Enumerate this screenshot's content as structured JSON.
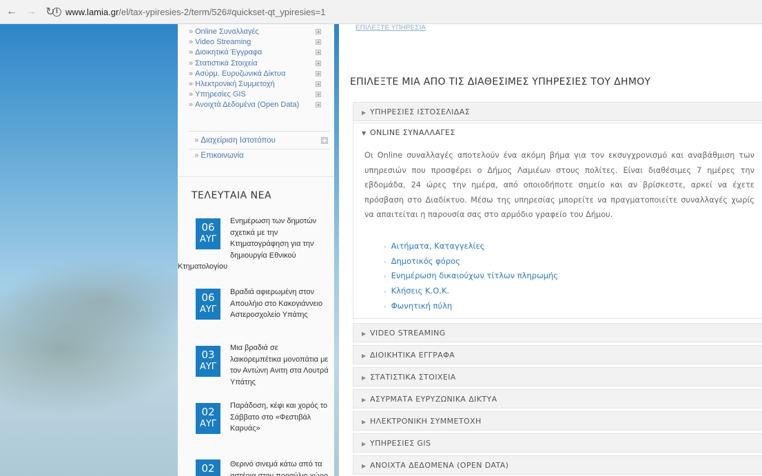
{
  "browser": {
    "url_host": "www.lamia.gr",
    "url_path": "/el/tax-ypiresies-2/term/526#quickset-qt_ypiresies=1"
  },
  "sidebar": {
    "submenu": [
      {
        "label": "Online Συναλλαγές"
      },
      {
        "label": "Video Streaming"
      },
      {
        "label": "Διοικητικά Έγγραφα"
      },
      {
        "label": "Στατιστικά Στοιχεία"
      },
      {
        "label": "Ασύρμ. Ευρυζωνικά Δίκτυα"
      },
      {
        "label": "Ηλεκτρονική Συμμετοχή"
      },
      {
        "label": "Υπηρεσίες GIS"
      },
      {
        "label": "Ανοιχτά Δεδομένα (Open Data)"
      }
    ],
    "main_items": [
      {
        "label": "Διαχείριση Ιστοτόπου"
      },
      {
        "label": "Επικοινωνία"
      }
    ],
    "news_heading": "ΤΕΛΕΥΤΑΙΑ ΝΕΑ",
    "news": [
      {
        "day": "06",
        "month": "ΑΥΓ",
        "text": "Ενημέρωση των δημοτών σχετικά με την Κτηματογράφηση για την δημιουργία Εθνικού Κτηματολογίου"
      },
      {
        "day": "06",
        "month": "ΑΥΓ",
        "text": "Βραδιά αφιερωμένη στον Απουλήιο στο Κακογιάννειο Αστεροσχολείο Υπάτης"
      },
      {
        "day": "03",
        "month": "ΑΥΓ",
        "text": "Μια βραδιά σε λαικορεμπέτικα μονοπάτια με τον Αντώνη Ανιτη στα Λουτρά Υπάτης"
      },
      {
        "day": "02",
        "month": "ΑΥΓ",
        "text": "Παράδοση, κέφι και χορός το Σάββατο στο «Φεστιβάλ Καρυάς»"
      },
      {
        "day": "02",
        "month": "",
        "text": "Θερινό σινεμά κάτω από τα αστέρια στον προαύλιο χώρο"
      }
    ]
  },
  "main": {
    "top_link": "ΕΠΙΛΕΞΤΕ ΥΠΗΡΕΣΙΑ",
    "section_title": "ΕΠΙΛΕΞΤΕ ΜΙΑ ΑΠΟ ΤΙΣ ΔΙΑΘΕΣΙΜΕΣ ΥΠΗΡΕΣΙΕΣ ΤΟΥ ΔΗΜΟΥ",
    "accordion_top": {
      "label": "ΥΠΗΡΕΣΙΕΣ ΙΣΤΟΣΕΛΙΔΑΣ"
    },
    "open_section": {
      "label": "ONLINE ΣΥΝΑΛΛΑΓΕΣ",
      "body": "Οι Online συναλλαγές αποτελούν ένα ακόμη βήμα για τον εκσυγχρονισμό και αναβάθμιση των υπηρεσιών που προσφέρει ο Δήμος Λαμιέων στους πολίτες. Είναι διαθέσιμες 7 ημέρες την εβδομάδα, 24 ώρες την ημέρα, από οποιοδήποτε σημείο και αν βρίσκεστε, αρκεί να έχετε πρόσβαση στο Διαδίκτυο. Μέσω της υπηρεσίας μπορείτε να πραγματοποιείτε συναλλαγές χωρίς να απαιτείται η παρουσία σας στο αρμόδιο γραφείο του Δήμου.",
      "links": [
        {
          "label": "Αιτήματα, Καταγγελίες"
        },
        {
          "label": "Δημοτικός φόρος"
        },
        {
          "label": "Ενημέρωση δικαιούχων τίτλων πληρωμής"
        },
        {
          "label": "Κλήσεις Κ.Ο.Κ."
        },
        {
          "label": "Φωνητική πύλη"
        }
      ]
    },
    "accordion": [
      {
        "label": "VIDEO STREAMING"
      },
      {
        "label": "ΔΙΟΙΚΗΤΙΚΑ ΕΓΓΡΑΦΑ"
      },
      {
        "label": "ΣΤΑΤΙΣΤΙΚΑ ΣΤΟΙΧΕΙΑ"
      },
      {
        "label": "ΑΣΥΡΜΑΤΑ ΕΥΡΥΖΩΝΙΚΑ ΔΙΚΤΥΑ"
      },
      {
        "label": "ΗΛΕΚΤΡΟΝΙΚΗ ΣΥΜΜΕΤΟΧΗ"
      },
      {
        "label": "ΥΠΗΡΕΣΙΕΣ GIS"
      },
      {
        "label": "ΑΝΟΙΧΤΑ ΔΕΔΟΜΕΝΑ (OPEN DATA)"
      }
    ]
  },
  "colors": {
    "accent": "#1a7dc1",
    "link": "#2c78b9",
    "accordion_bg": "#f2f2f2"
  }
}
